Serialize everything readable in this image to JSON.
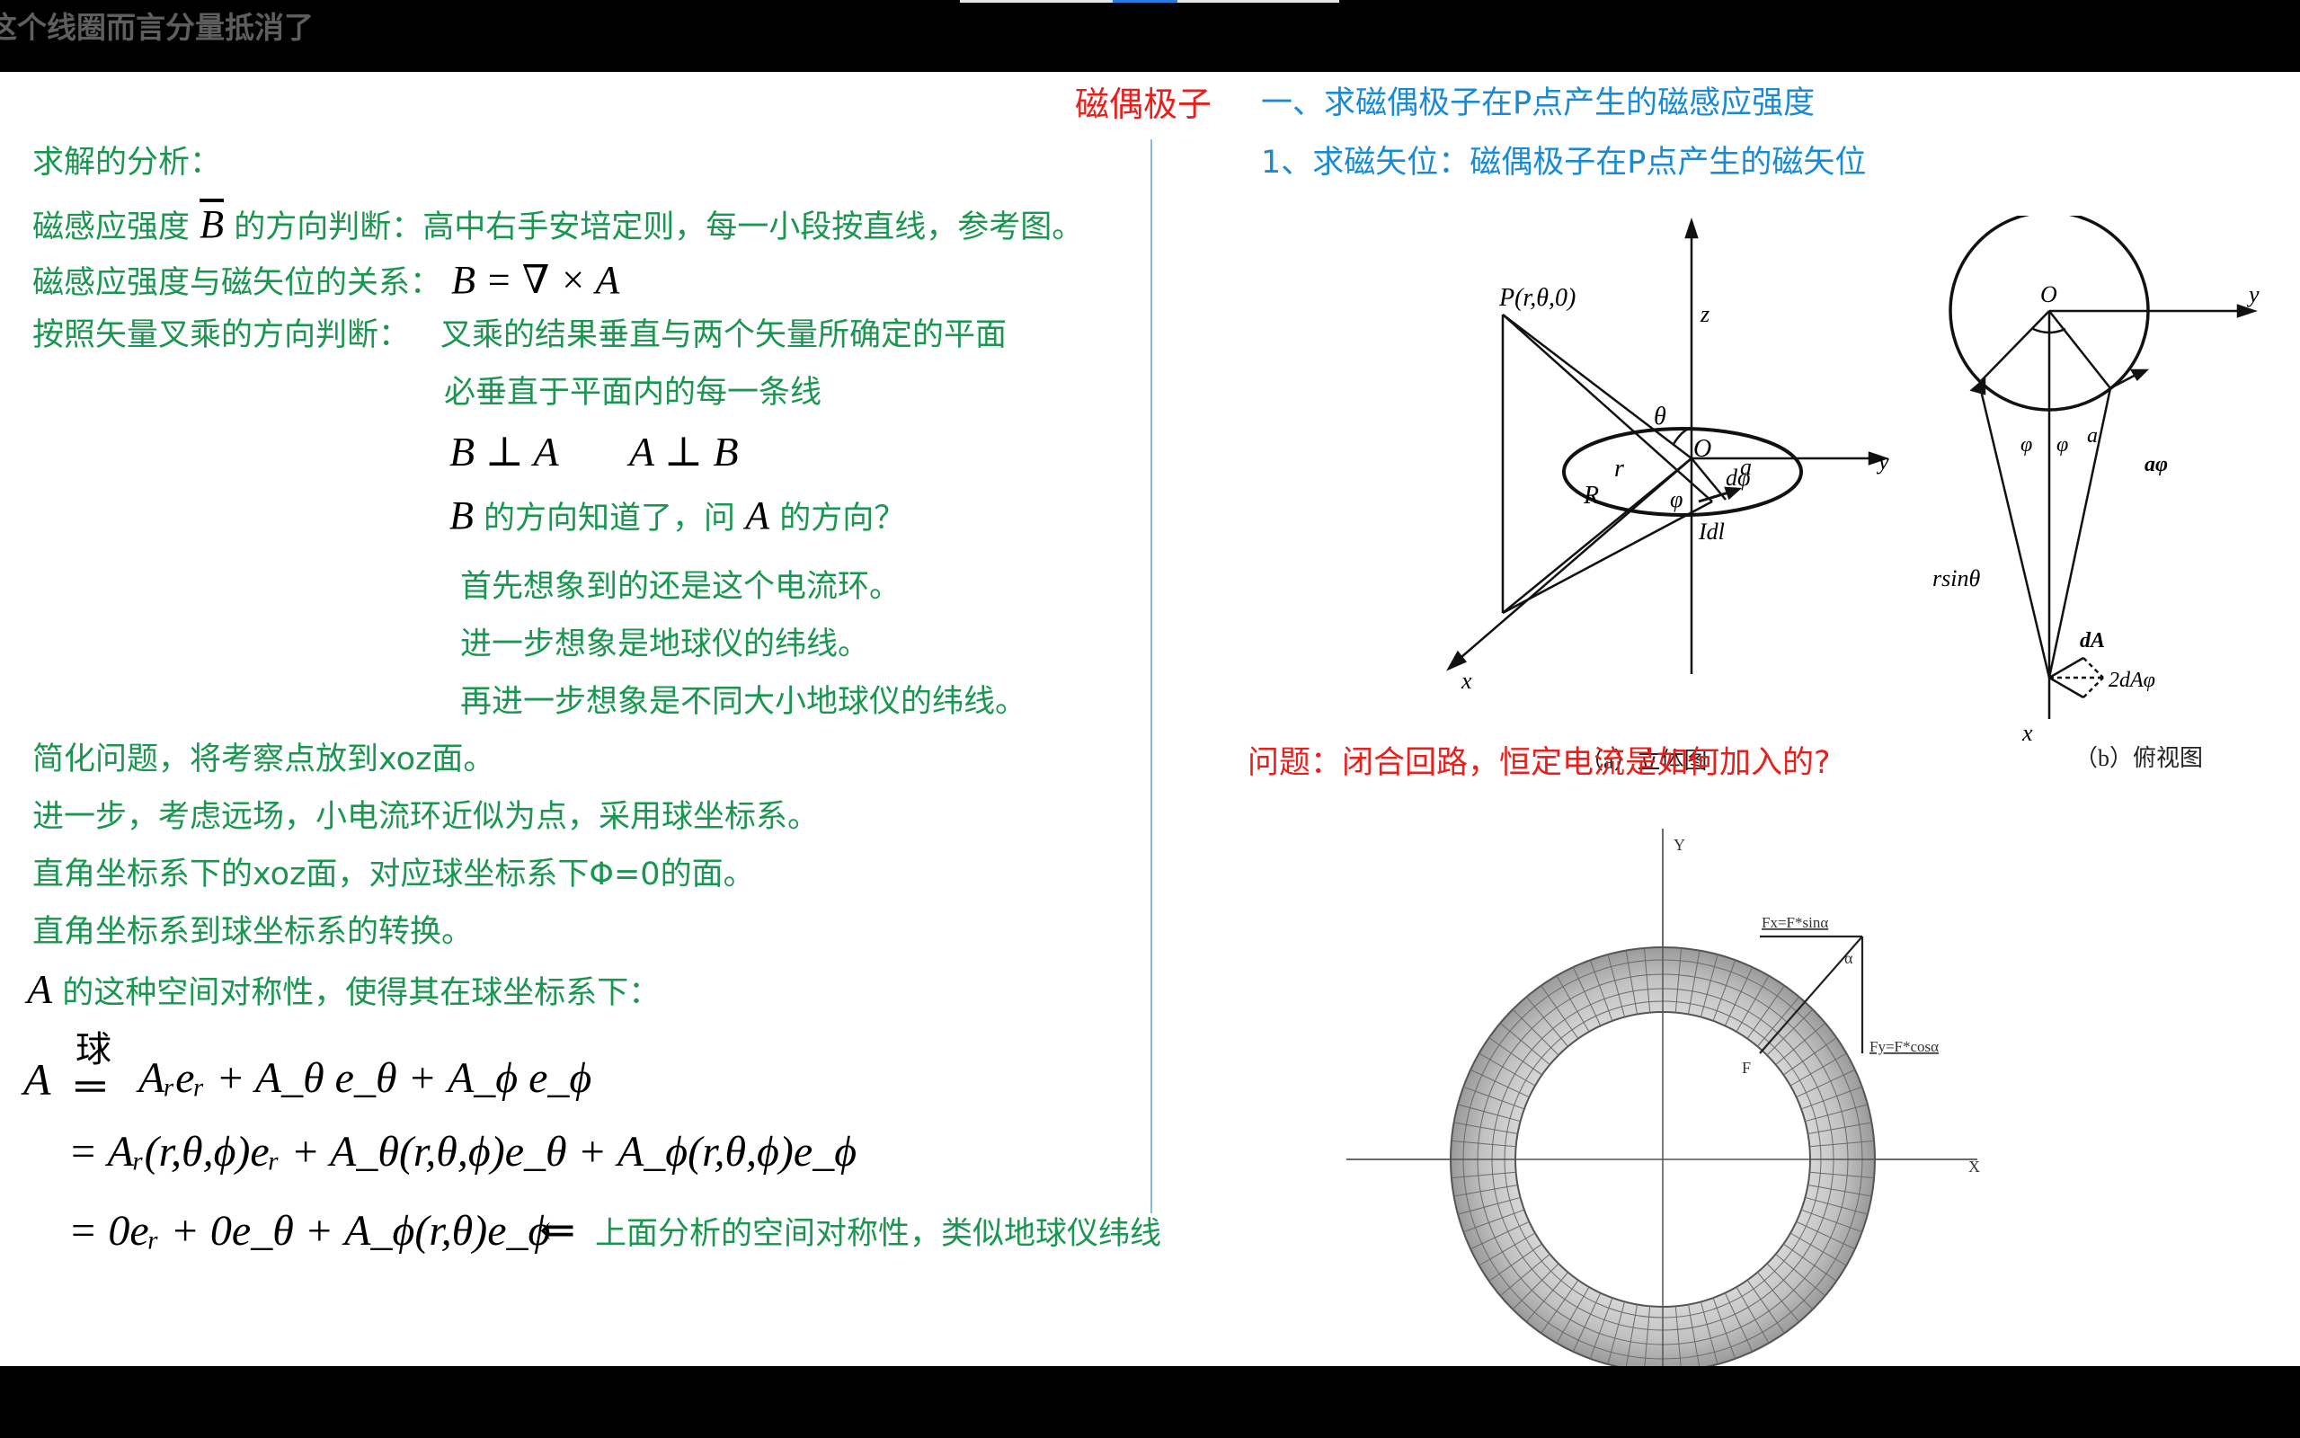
{
  "window": {
    "caption": "这个线圈而言分量抵消了"
  },
  "header": {
    "topic": "磁偶极子",
    "subtitle": "一、求磁偶极子在P点产生的磁感应强度",
    "step": "1、求磁矢位：磁偶极子在P点产生的磁矢位"
  },
  "left": {
    "l1": "求解的分析：",
    "l2a": "磁感应强度",
    "l2b": "B",
    "l2c": "的方向判断：高中右手安培定则，每一小段按直线，参考图。",
    "l3a": "磁感应强度与磁矢位的关系：",
    "l3b": "B = ∇ × A",
    "l4a": "按照矢量叉乘的方向判断：",
    "l4b": "叉乘的结果垂直与两个矢量所确定的平面",
    "l5": "必垂直于平面内的每一条线",
    "l6a": "B ⊥ A",
    "l6b": "A ⊥ B",
    "l7a": "B",
    "l7b": "的方向知道了，问",
    "l7c": "A",
    "l7d": "的方向？",
    "l8": "首先想象到的还是这个电流环。",
    "l9": "进一步想象是地球仪的纬线。",
    "l10": "再进一步想象是不同大小地球仪的纬线。",
    "l11": "简化问题，将考察点放到xoz面。",
    "l12": "进一步，考虑远场，小电流环近似为点，采用球坐标系。",
    "l13": "直角坐标系下的xoz面，对应球坐标系下Φ=0的面。",
    "l14": "直角坐标系到球坐标系的转换。",
    "l15a": "A",
    "l15b": "的这种空间对称性，使得其在球坐标系下：",
    "eqLabel": "球",
    "eq1lhs": "A",
    "eq1": "Aᵣeᵣ + A_θ e_θ + A_ϕ e_ϕ",
    "eq2": "= Aᵣ(r,θ,ϕ)eᵣ + A_θ(r,θ,ϕ)e_θ + A_ϕ(r,θ,ϕ)e_ϕ",
    "eq3": "= 0eᵣ + 0e_θ + A_ϕ(r,θ)e_ϕ",
    "eq3arrow": "⇐",
    "eq3note": "上面分析的空间对称性，类似地球仪纬线"
  },
  "figA": {
    "P": "P(r,θ,0)",
    "z": "z",
    "y": "y",
    "x": "x",
    "theta": "θ",
    "r": "r",
    "R": "R",
    "O": "O",
    "a": "a",
    "phi": "φ",
    "dphi": "dφ",
    "Idl": "Idl",
    "caption": "（a）立体图"
  },
  "figB": {
    "O": "O",
    "y": "y",
    "x": "x",
    "phi1": "φ",
    "phi2": "φ",
    "a": "a",
    "aphi": "aφ",
    "rsin": "rsinθ",
    "dA": "dA",
    "twodA": "2dAφ",
    "caption": "（b）俯视图"
  },
  "question": "问题：闭合回路，恒定电流是如何加入的?",
  "torus": {
    "Y": "Y",
    "X": "X",
    "F": "F",
    "alpha": "α",
    "fx": "Fx=F*sinα",
    "fy": "Fy=F*cosα"
  }
}
